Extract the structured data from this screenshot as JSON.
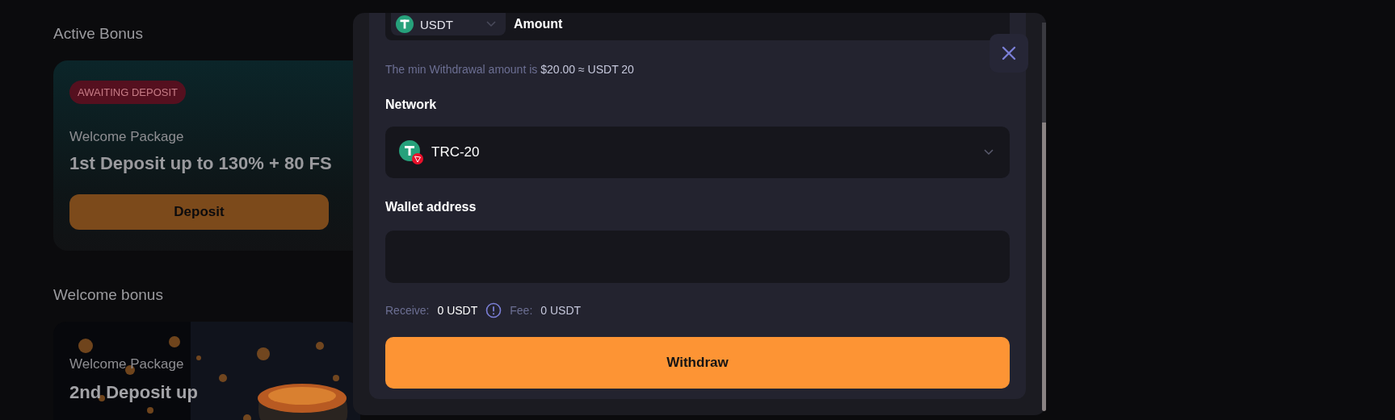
{
  "background": {
    "active_bonus": {
      "title": "Active Bonus",
      "badge": "AWAITING DEPOSIT",
      "subtitle": "Welcome Package",
      "headline": "1st Deposit up to 130% + 80 FS",
      "button": "Deposit"
    },
    "welcome_bonus": {
      "title": "Welcome bonus",
      "cards": [
        {
          "kind": "picture",
          "subtitle": "Welcome Package",
          "headline": "2nd Deposit up"
        }
      ]
    }
  },
  "withdraw_modal": {
    "currency": "USDT",
    "amount_label": "Amount",
    "min_note": {
      "text": "The min Withdrawal amount is",
      "value": "$20.00 ≈ USDT 20"
    },
    "network_label": "Network",
    "network": "TRC-20",
    "wallet_label": "Wallet address",
    "receive_label": "Receive:",
    "receive_value": "0 USDT",
    "fee_label": "Fee:",
    "fee_value": "0 USDT",
    "button": "Withdraw"
  }
}
